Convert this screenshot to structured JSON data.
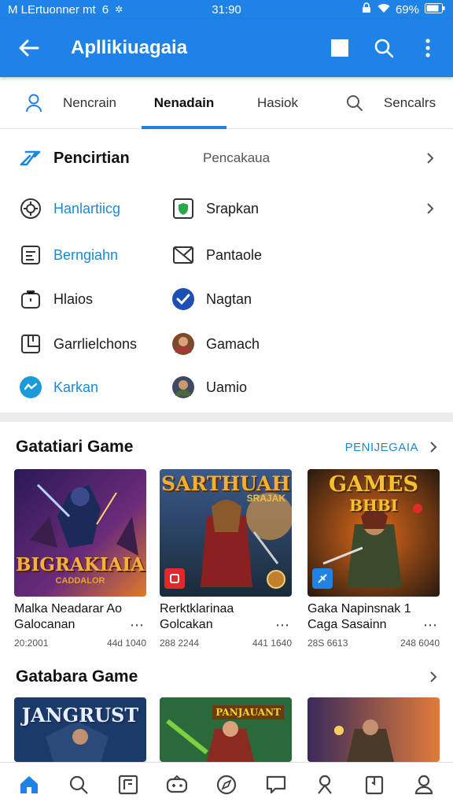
{
  "status_bar": {
    "left_text": "M LErtuonner mt",
    "left_num": "6",
    "time": "31:90",
    "battery": "69%"
  },
  "app_bar": {
    "title": "Apllikiuagaia",
    "color": "#1f82e6"
  },
  "tabs": [
    {
      "label": "Nencrain",
      "active": false,
      "icon": "person-icon"
    },
    {
      "label": "Nenadain",
      "active": true
    },
    {
      "label": "Hasiok",
      "active": false
    },
    {
      "label": "Sencalrs",
      "active": false,
      "icon": "search-icon"
    }
  ],
  "menu": {
    "header": {
      "label": "Pencirtian",
      "value": "Pencakaua",
      "icon": "link-icon"
    },
    "left": [
      {
        "label": "Hanlartiicg",
        "icon": "settings-icon",
        "highlight": true
      },
      {
        "label": "Berngiahn",
        "icon": "document-icon",
        "highlight": true
      },
      {
        "label": "Hlaios",
        "icon": "bag-icon",
        "highlight": false
      },
      {
        "label": "Garrlielchons",
        "icon": "grid-icon",
        "highlight": false
      },
      {
        "label": "Karkan",
        "icon": "chat-icon",
        "highlight": true
      }
    ],
    "right": [
      {
        "label": "Srapkan",
        "icon": "shield-icon"
      },
      {
        "label": "Pantaole",
        "icon": "mail-icon"
      },
      {
        "label": "Nagtan",
        "icon": "check-circle-icon"
      },
      {
        "label": "Gamach",
        "icon": "avatar-icon"
      },
      {
        "label": "Uamio",
        "icon": "avatar-icon"
      }
    ]
  },
  "section1": {
    "title": "Gatatiari Game",
    "link": "PENIJEGAIA",
    "cards": [
      {
        "name": "Malka Neadarar Ao Galocanan",
        "left_meta": "20:2001",
        "right_meta": "44d 1040",
        "thumb_text": "BIGRAKIAIA",
        "thumb_sub": "CADDALOR"
      },
      {
        "name": "Rerktklarinaa Golcakan",
        "left_meta": "288 2244",
        "right_meta": "441 1640",
        "thumb_text": "SARTHUAH",
        "thumb_sub": "SRAJAK",
        "badge": "red"
      },
      {
        "name": "Gaka Napinsnak 1 Caga Sasainn",
        "left_meta": "28S 6613",
        "right_meta": "248 6040",
        "thumb_text": "GAMES",
        "thumb_sub": "BHBI",
        "badge": "blue"
      }
    ]
  },
  "section2": {
    "title": "Gatabara Game",
    "cards": [
      {
        "thumb_text": "JANGRUST"
      },
      {
        "thumb_text": "PANJAUANT"
      },
      {
        "thumb_text": ""
      }
    ]
  },
  "bottom_nav": [
    "home-icon",
    "search-icon",
    "news-icon",
    "games-icon",
    "compass-icon",
    "message-icon",
    "person-icon",
    "bookmark-icon",
    "account-icon"
  ]
}
